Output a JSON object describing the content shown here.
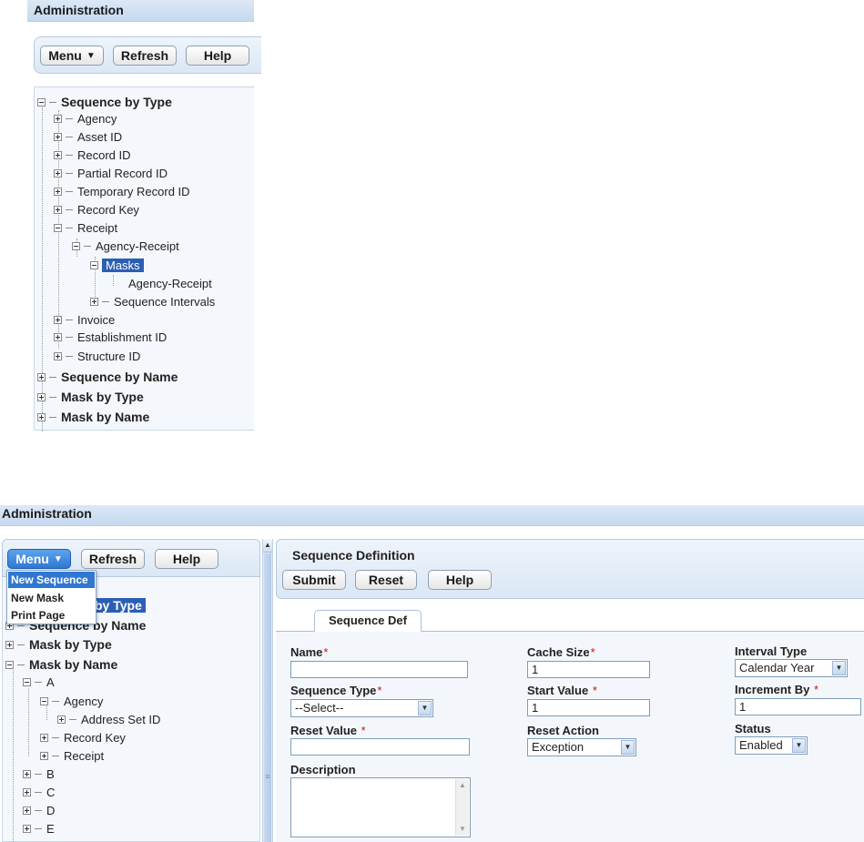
{
  "top": {
    "title": "Administration",
    "toolbar": {
      "menu": "Menu",
      "refresh": "Refresh",
      "help": "Help"
    },
    "tree": {
      "root": "Sequence by Type",
      "children": [
        "Agency",
        "Asset ID",
        "Record ID",
        "Partial Record ID",
        "Temporary Record ID",
        "Record Key",
        "Receipt"
      ],
      "receipt_child": "Agency-Receipt",
      "masks": "Masks",
      "masks_child": "Agency-Receipt",
      "sequence_intervals": "Sequence Intervals",
      "after": [
        "Invoice",
        "Establishment ID",
        "Structure ID"
      ],
      "roots": [
        "Sequence by Name",
        "Mask by Type",
        "Mask by Name"
      ]
    }
  },
  "bottom": {
    "title": "Administration",
    "toolbar": {
      "menu": "Menu",
      "refresh": "Refresh",
      "help": "Help"
    },
    "dropdown": [
      "New Sequence",
      "New Mask",
      "Print Page"
    ],
    "tree": {
      "partial_root": "by Type",
      "roots": [
        "Sequence by Name",
        "Mask by Type",
        "Mask by Name"
      ],
      "a": "A",
      "agency": "Agency",
      "address": "Address Set ID",
      "record_key": "Record Key",
      "receipt": "Receipt",
      "letters": [
        "B",
        "C",
        "D",
        "E"
      ]
    },
    "form": {
      "title": "Sequence Definition",
      "submit": "Submit",
      "reset": "Reset",
      "help": "Help",
      "tab": "Sequence Def",
      "name_label": "Name",
      "name_value": "",
      "cache_label": "Cache Size",
      "cache_value": "1",
      "interval_label": "Interval Type",
      "interval_value": "Calendar Year",
      "seqtype_label": "Sequence Type",
      "seqtype_value": "--Select--",
      "start_label": "Start Value",
      "start_value": "1",
      "increment_label": "Increment By",
      "increment_value": "1",
      "resetval_label": "Reset Value",
      "resetval_value": "",
      "resetaction_label": "Reset Action",
      "resetaction_value": "Exception",
      "status_label": "Status",
      "status_value": "Enabled",
      "description_label": "Description",
      "description_value": "",
      "required_mark": "*"
    },
    "scroll": {
      "up": "▲",
      "grip": "≡"
    }
  }
}
